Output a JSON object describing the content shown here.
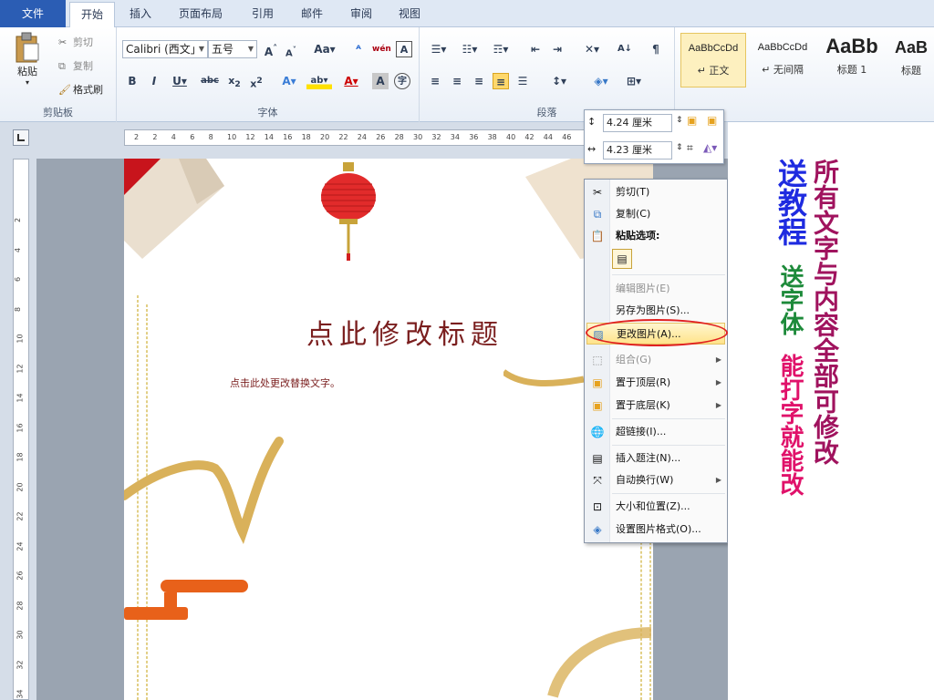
{
  "tabs": [
    {
      "label": "文件"
    },
    {
      "label": "开始"
    },
    {
      "label": "插入"
    },
    {
      "label": "页面布局"
    },
    {
      "label": "引用"
    },
    {
      "label": "邮件"
    },
    {
      "label": "审阅"
    },
    {
      "label": "视图"
    }
  ],
  "clipboard": {
    "paste_label": "粘贴",
    "cut_label": "剪切",
    "copy_label": "复制",
    "format_painter_label": "格式刷",
    "group_label": "剪贴板"
  },
  "font": {
    "font_name": "Calibri (西文」",
    "font_size": "五号",
    "group_label": "字体"
  },
  "paragraph": {
    "group_label": "段落"
  },
  "styles": [
    {
      "sample": "AaBbCcDd",
      "name": "↵ 正文"
    },
    {
      "sample": "AaBbCcDd",
      "name": "↵ 无间隔"
    },
    {
      "sample": "AaBb",
      "name": "标题 1"
    },
    {
      "sample": "AaB",
      "name": "标题"
    }
  ],
  "ruler_h": [
    "2",
    "2",
    "4",
    "6",
    "8",
    "10",
    "12",
    "14",
    "16",
    "18",
    "20",
    "22",
    "24",
    "26",
    "28",
    "30",
    "32",
    "34",
    "36",
    "38",
    "40",
    "42",
    "44",
    "46"
  ],
  "ruler_v": [
    "2",
    "4",
    "6",
    "8",
    "10",
    "12",
    "14",
    "16",
    "18",
    "20",
    "22",
    "24",
    "26",
    "28",
    "30",
    "32",
    "34",
    "36"
  ],
  "picture_size": {
    "height": "4.24 厘米",
    "width": "4.23 厘米"
  },
  "document": {
    "title": "点此修改标题",
    "body": "点击此处更改替换文字。"
  },
  "context_menu": {
    "cut": "剪切(T)",
    "copy": "复制(C)",
    "paste_options": "粘贴选项:",
    "edit_picture": "编辑图片(E)",
    "save_as_picture": "另存为图片(S)...",
    "change_picture": "更改图片(A)...",
    "group": "组合(G)",
    "bring_to_front": "置于顶层(R)",
    "send_to_back": "置于底层(K)",
    "hyperlink": "超链接(I)...",
    "insert_caption": "插入题注(N)...",
    "wrap_text": "自动换行(W)",
    "size_position": "大小和位置(Z)...",
    "format_picture": "设置图片格式(O)..."
  },
  "promo": {
    "line_blue": "送教程",
    "line_green": "送字体",
    "line_purple": "所有文字与内容全部可修改",
    "line_red": "能打字就能改"
  }
}
